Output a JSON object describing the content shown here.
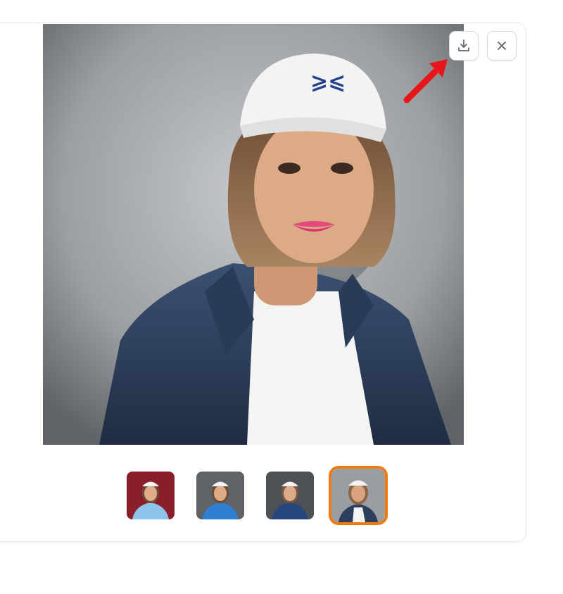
{
  "viewer": {
    "download_button": {
      "icon": "download-icon",
      "label": "Download"
    },
    "close_button": {
      "icon": "close-icon",
      "label": "Close"
    },
    "annotation_color": "#e8161b"
  },
  "main_image": {
    "description_icon": "portrait-image",
    "colors": {
      "background": "#8a8d91",
      "jacket": "#2d3f5c",
      "shirt": "#f6f6f4",
      "cap": "#f3f3f3",
      "cap_logo": "#24418e",
      "hair": "#8a6646",
      "skin": "#d9a47f"
    }
  },
  "thumbnails": [
    {
      "name": "thumbnail-1",
      "bg": "#8a1f2a",
      "top": "#8ec3ec",
      "selected": false
    },
    {
      "name": "thumbnail-2",
      "bg": "#5f6266",
      "top": "#2f7fd3",
      "selected": false
    },
    {
      "name": "thumbnail-3",
      "bg": "#4d5055",
      "top": "#25477d",
      "selected": false
    },
    {
      "name": "thumbnail-4",
      "bg": "#9a9da1",
      "top": "#2d3f5c",
      "selected": true
    }
  ],
  "selected_border_color": "#f07a12"
}
